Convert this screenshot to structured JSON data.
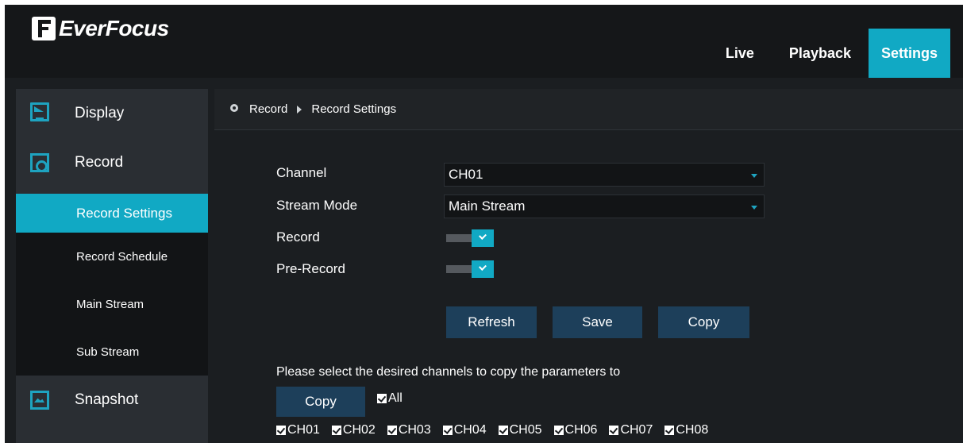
{
  "header": {
    "logo_text": "EverFocus",
    "nav": [
      {
        "label": "Live",
        "active": false
      },
      {
        "label": "Playback",
        "active": false
      },
      {
        "label": "Settings",
        "active": true
      }
    ],
    "accent_color": "#11a9c4"
  },
  "sidebar": {
    "display_label": "Display",
    "record_label": "Record",
    "record_items": [
      {
        "label": "Record Settings",
        "active": true
      },
      {
        "label": "Record Schedule",
        "active": false
      },
      {
        "label": "Main Stream",
        "active": false
      },
      {
        "label": "Sub Stream",
        "active": false
      }
    ],
    "snapshot_label": "Snapshot",
    "icons": [
      "display-icon",
      "record-icon",
      "snapshot-icon"
    ]
  },
  "breadcrumb": {
    "section": "Record",
    "page": "Record Settings"
  },
  "form": {
    "channel_label": "Channel",
    "channel_value": "CH01",
    "stream_mode_label": "Stream Mode",
    "stream_mode_value": "Main Stream",
    "record_label": "Record",
    "record_on": true,
    "pre_record_label": "Pre-Record",
    "pre_record_on": true
  },
  "buttons": {
    "refresh": "Refresh",
    "save": "Save",
    "copy": "Copy"
  },
  "copy_section": {
    "hint": "Please select the desired channels to copy the parameters to",
    "copy_button": "Copy",
    "all_label": "All",
    "all_checked": true,
    "channels": [
      {
        "label": "CH01",
        "checked": true
      },
      {
        "label": "CH02",
        "checked": true
      },
      {
        "label": "CH03",
        "checked": true
      },
      {
        "label": "CH04",
        "checked": true
      },
      {
        "label": "CH05",
        "checked": true
      },
      {
        "label": "CH06",
        "checked": true
      },
      {
        "label": "CH07",
        "checked": true
      },
      {
        "label": "CH08",
        "checked": true
      }
    ]
  }
}
